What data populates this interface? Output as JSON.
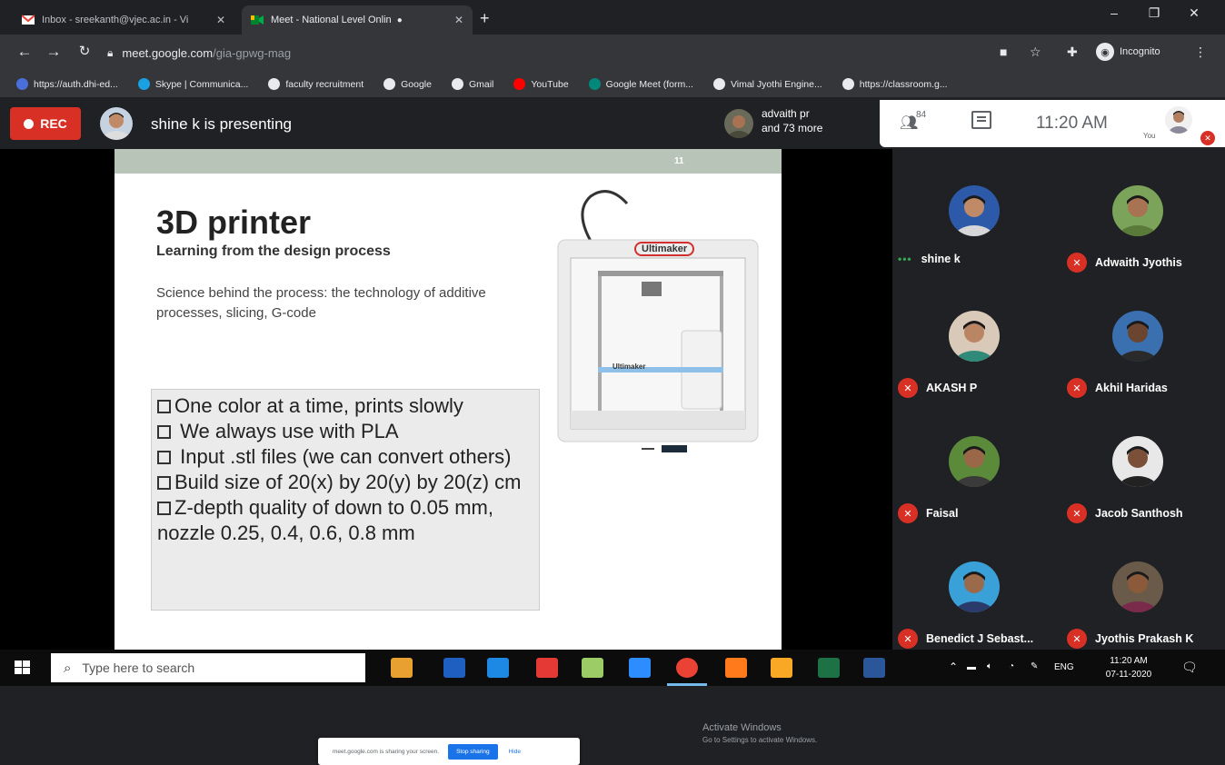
{
  "browser": {
    "tabs": [
      {
        "title": "Inbox - sreekanth@vjec.ac.in - Vi",
        "favicon": "gmail-icon",
        "active": false
      },
      {
        "title": "Meet - National Level Onlin",
        "favicon": "meet-icon",
        "active": true
      }
    ],
    "new_tab": "+",
    "url_host": "meet.google.com",
    "url_path": "/gia-gpwg-mag",
    "incognito_label": "Incognito",
    "bookmarks": [
      {
        "label": "https://auth.dhi-ed...",
        "color": "#4a6fd8"
      },
      {
        "label": "Skype | Communica...",
        "color": "#1aa1e2"
      },
      {
        "label": "faculty recruitment",
        "color": "#e8eaed"
      },
      {
        "label": "Google",
        "color": "#e8eaed"
      },
      {
        "label": "Gmail",
        "color": "#e8eaed"
      },
      {
        "label": "YouTube",
        "color": "#ff0000"
      },
      {
        "label": "Google Meet (form...",
        "color": "#00897b"
      },
      {
        "label": "Vimal Jyothi Engine...",
        "color": "#e8eaed"
      },
      {
        "label": "https://classroom.g...",
        "color": "#e8eaed"
      }
    ]
  },
  "meet": {
    "rec_label": "REC",
    "presenter_text": "shine k is presenting",
    "pinned_name": "advaith pr",
    "pinned_more": "and 73 more",
    "people_count": "84",
    "time": "11:20 AM",
    "you_label": "You",
    "participants": [
      {
        "name": "shine k",
        "speaking": true,
        "bg": "#2d5aa8",
        "skin": "#c08a66",
        "shirt": "#d7d7d7"
      },
      {
        "name": "Adwaith Jyothis",
        "speaking": false,
        "bg": "#7ba35a",
        "skin": "#a87352",
        "shirt": "#5a7a3a"
      },
      {
        "name": "AKASH P",
        "speaking": false,
        "bg": "#d9c9b8",
        "skin": "#b98563",
        "shirt": "#2f8a7a"
      },
      {
        "name": "Akhil Haridas",
        "speaking": false,
        "bg": "#3a6fb0",
        "skin": "#6b4530",
        "shirt": "#2a2a2a"
      },
      {
        "name": "Faisal",
        "speaking": false,
        "bg": "#5a8a3a",
        "skin": "#9a6848",
        "shirt": "#3a3a3a"
      },
      {
        "name": "Jacob Santhosh",
        "speaking": false,
        "bg": "#e8e8e8",
        "skin": "#7a5038",
        "shirt": "#222222"
      },
      {
        "name": "Benedict J Sebast...",
        "speaking": false,
        "bg": "#3aa0d8",
        "skin": "#9a6a4a",
        "shirt": "#2a3a6a"
      },
      {
        "name": "Jyothis Prakash K",
        "speaking": false,
        "bg": "#6a5a4a",
        "skin": "#8a5a3a",
        "shirt": "#7a2a4a"
      }
    ]
  },
  "slide": {
    "number": "11",
    "title": "3D printer",
    "subtitle": "Learning from the design process",
    "body": "Science behind the process: the technology of additive processes, slicing, G-code",
    "bullets": [
      "One color at a time, prints slowly",
      " We always use with PLA",
      " Input .stl files (we can convert others)",
      "Build size of 20(x) by 20(y) by 20(z) cm",
      "Z-depth quality of down to 0.05 mm, nozzle 0.25, 0.4, 0.6, 0.8 mm"
    ],
    "brand_top": "Ultimaker",
    "brand_bar": "Ultimaker"
  },
  "share": {
    "message": "meet.google.com is sharing your screen.",
    "stop": "Stop sharing",
    "hide": "Hide"
  },
  "watermark": {
    "line1": "Activate Windows",
    "line2": "Go to Settings to activate Windows."
  },
  "taskbar": {
    "search_placeholder": "Type here to search",
    "language": "ENG",
    "time": "11:20 AM",
    "date": "07-11-2020",
    "apps": [
      "#e8a030",
      "#1f5fbf",
      "#1e88e5",
      "#e53935",
      "#9ccc65",
      "#2d8cff",
      "#ea4335",
      "#ff7a1a",
      "#f9a825",
      "#1e7145",
      "#2b579a"
    ]
  }
}
